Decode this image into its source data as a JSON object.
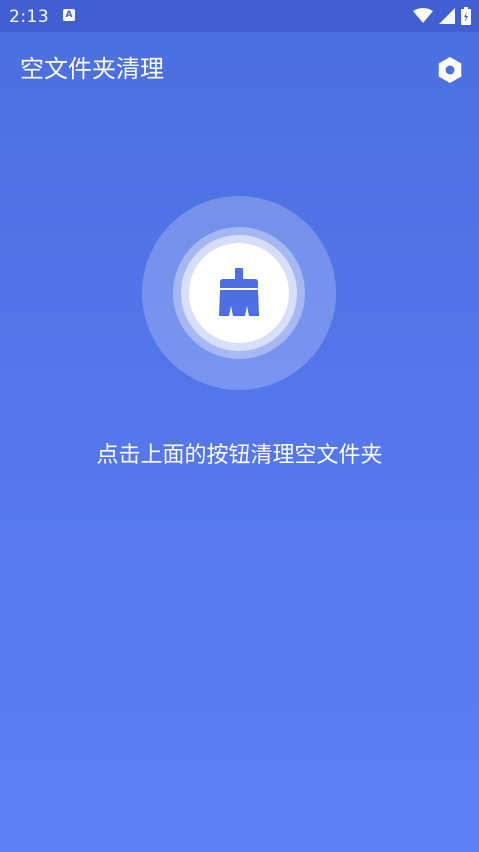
{
  "status_bar": {
    "time": "2:13",
    "app_icon_letter": "A",
    "icons": [
      "wifi-icon",
      "signal-icon",
      "battery-icon"
    ]
  },
  "toolbar": {
    "title": "空文件夹清理",
    "settings_icon": "gear-icon"
  },
  "main": {
    "clean_button_icon": "broom-icon",
    "hint": "点击上面的按钮清理空文件夹"
  },
  "colors": {
    "status_bar": "#3f5fd2",
    "background_top": "#4a6fe0",
    "background_bottom": "#5b80f6",
    "accent": "#4d6fe3"
  }
}
